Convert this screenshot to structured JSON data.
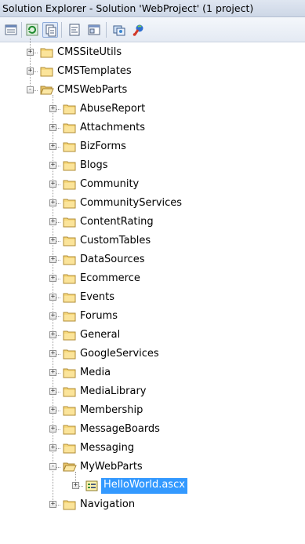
{
  "window": {
    "title": "Solution Explorer - Solution 'WebProject' (1 project)"
  },
  "toolbar": {
    "buttons": [
      "properties-icon",
      "refresh-icon",
      "show-all-files-icon",
      "view-code-icon",
      "view-designer-icon",
      "copy-website-icon",
      "asp-net-configuration-icon"
    ]
  },
  "tree": {
    "items": [
      {
        "label": "CMSSiteUtils",
        "expander": "+",
        "icon": "folder-icon"
      },
      {
        "label": "CMSTemplates",
        "expander": "+",
        "icon": "folder-icon"
      },
      {
        "label": "CMSWebParts",
        "expander": "-",
        "icon": "folder-open-icon"
      },
      {
        "label": "AbuseReport",
        "expander": "+",
        "icon": "folder-icon"
      },
      {
        "label": "Attachments",
        "expander": "+",
        "icon": "folder-icon"
      },
      {
        "label": "BizForms",
        "expander": "+",
        "icon": "folder-icon"
      },
      {
        "label": "Blogs",
        "expander": "+",
        "icon": "folder-icon"
      },
      {
        "label": "Community",
        "expander": "+",
        "icon": "folder-icon"
      },
      {
        "label": "CommunityServices",
        "expander": "+",
        "icon": "folder-icon"
      },
      {
        "label": "ContentRating",
        "expander": "+",
        "icon": "folder-icon"
      },
      {
        "label": "CustomTables",
        "expander": "+",
        "icon": "folder-icon"
      },
      {
        "label": "DataSources",
        "expander": "+",
        "icon": "folder-icon"
      },
      {
        "label": "Ecommerce",
        "expander": "+",
        "icon": "folder-icon"
      },
      {
        "label": "Events",
        "expander": "+",
        "icon": "folder-icon"
      },
      {
        "label": "Forums",
        "expander": "+",
        "icon": "folder-icon"
      },
      {
        "label": "General",
        "expander": "+",
        "icon": "folder-icon"
      },
      {
        "label": "GoogleServices",
        "expander": "+",
        "icon": "folder-icon"
      },
      {
        "label": "Media",
        "expander": "+",
        "icon": "folder-icon"
      },
      {
        "label": "MediaLibrary",
        "expander": "+",
        "icon": "folder-icon"
      },
      {
        "label": "Membership",
        "expander": "+",
        "icon": "folder-icon"
      },
      {
        "label": "MessageBoards",
        "expander": "+",
        "icon": "folder-icon"
      },
      {
        "label": "Messaging",
        "expander": "+",
        "icon": "folder-icon"
      },
      {
        "label": "MyWebParts",
        "expander": "-",
        "icon": "folder-open-icon"
      },
      {
        "label": "HelloWorld.ascx",
        "expander": "+",
        "icon": "user-control-icon",
        "selected": true
      },
      {
        "label": "Navigation",
        "expander": "+",
        "icon": "folder-icon"
      }
    ]
  }
}
